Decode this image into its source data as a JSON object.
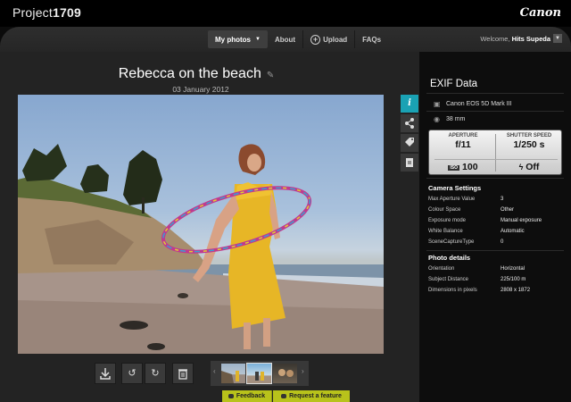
{
  "header": {
    "brand_light": "Project",
    "brand_bold": "1709",
    "logo": "Canon"
  },
  "nav": {
    "items": [
      {
        "label": "My photos",
        "active": true
      },
      {
        "label": "About"
      },
      {
        "label": "Upload",
        "icon": "plus-circle-icon"
      },
      {
        "label": "FAQs"
      }
    ],
    "welcome_prefix": "Welcome,",
    "username": "Hits Supeda"
  },
  "photo": {
    "title": "Rebecca on the beach",
    "date": "03 January 2012"
  },
  "side_tools": [
    {
      "name": "info-tool",
      "icon": "info-icon",
      "active": true
    },
    {
      "name": "share-tool",
      "icon": "share-icon"
    },
    {
      "name": "tag-tool",
      "icon": "tag-icon"
    },
    {
      "name": "notes-tool",
      "icon": "note-icon"
    }
  ],
  "exif": {
    "title": "EXIF Data",
    "camera": "Canon EOS 5D Mark III",
    "focal_length": "38 mm",
    "aperture_label": "APERTURE",
    "aperture": "f/11",
    "shutter_label": "SHUTTER SPEED",
    "shutter": "1/250 s",
    "iso_badge": "ISO",
    "iso": "100",
    "flash": "Off",
    "camera_settings_title": "Camera Settings",
    "camera_settings": [
      {
        "k": "Max Aperture Value",
        "v": "3"
      },
      {
        "k": "Colour Space",
        "v": "Other"
      },
      {
        "k": "Exposure mode",
        "v": "Manual exposure"
      },
      {
        "k": "White Balance",
        "v": "Automatic"
      },
      {
        "k": "SceneCaptureType",
        "v": "0"
      }
    ],
    "photo_details_title": "Photo details",
    "photo_details": [
      {
        "k": "Orientation",
        "v": "Horizontal"
      },
      {
        "k": "Subject Distance",
        "v": "225/100 m"
      },
      {
        "k": "Dimensions in pixels",
        "v": "2808 x 1872"
      }
    ]
  },
  "toolbar": [
    {
      "name": "download-button",
      "icon": "download-icon"
    },
    {
      "name": "rotate-left-button",
      "icon": "rotate-left-icon"
    },
    {
      "name": "rotate-right-button",
      "icon": "rotate-right-icon"
    },
    {
      "name": "delete-button",
      "icon": "trash-icon"
    }
  ],
  "feedback": {
    "feedback_label": "Feedback",
    "request_label": "Request a feature"
  },
  "colors": {
    "accent": "#1aa2b4",
    "feedback": "#b8c21b",
    "panel": "#0d0d0d"
  }
}
